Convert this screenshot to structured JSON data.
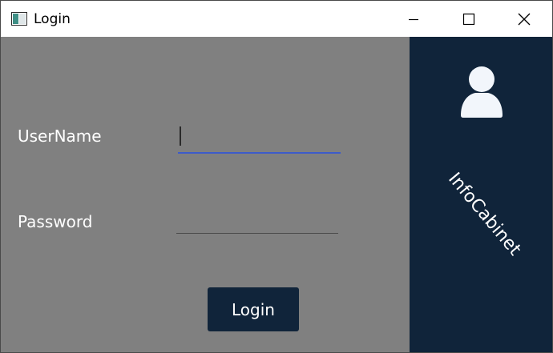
{
  "window": {
    "title": "Login",
    "controls": {
      "minimize": "minimize",
      "maximize": "maximize",
      "close": "close"
    }
  },
  "form": {
    "username_label": "UserName",
    "username_value": "",
    "password_label": "Password",
    "password_value": "",
    "login_button": "Login"
  },
  "side_panel": {
    "icon": "user-icon",
    "brand": "InfoCabinet"
  },
  "colors": {
    "content_bg": "#808080",
    "panel_bg": "#10243a",
    "focus_underline": "#3d5bc9",
    "button_bg": "#10243a"
  }
}
